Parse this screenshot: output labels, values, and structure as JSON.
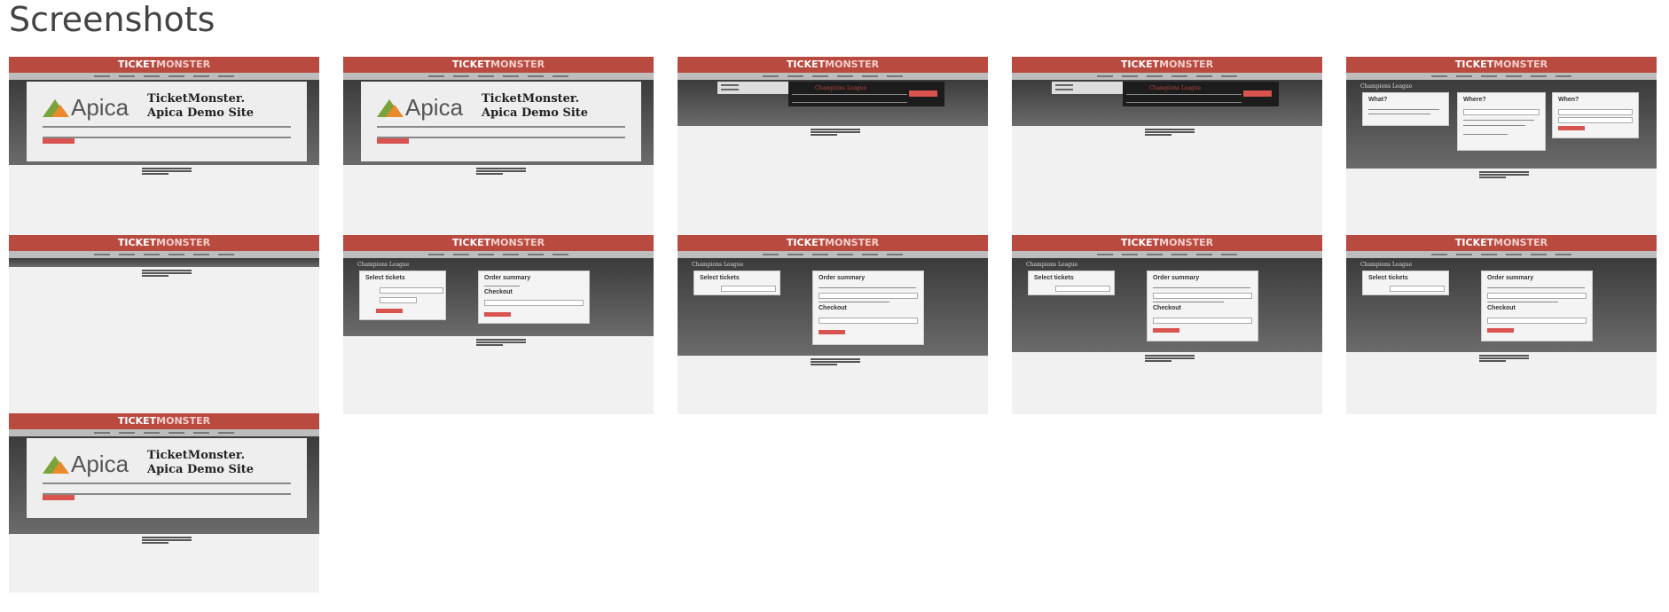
{
  "page": {
    "title": "Screenshots"
  },
  "app": {
    "brand_first": "TICKET",
    "brand_second": "MONSTER"
  },
  "hero": {
    "logo_text": "Apica",
    "title_line1": "TicketMonster.",
    "title_line2": "Apica Demo Site"
  },
  "event": {
    "name": "Champions League"
  },
  "venue": {
    "what": "What?",
    "where": "Where?",
    "when": "When?"
  },
  "booking": {
    "select_tickets": "Select tickets",
    "order_summary": "Order summary",
    "checkout": "Checkout"
  },
  "screenshots": [
    {
      "kind": "home"
    },
    {
      "kind": "home"
    },
    {
      "kind": "event"
    },
    {
      "kind": "event"
    },
    {
      "kind": "venue"
    },
    {
      "kind": "empty"
    },
    {
      "kind": "booking"
    },
    {
      "kind": "booking-tickets"
    },
    {
      "kind": "booking-tickets"
    },
    {
      "kind": "booking-tickets"
    },
    {
      "kind": "home"
    }
  ]
}
